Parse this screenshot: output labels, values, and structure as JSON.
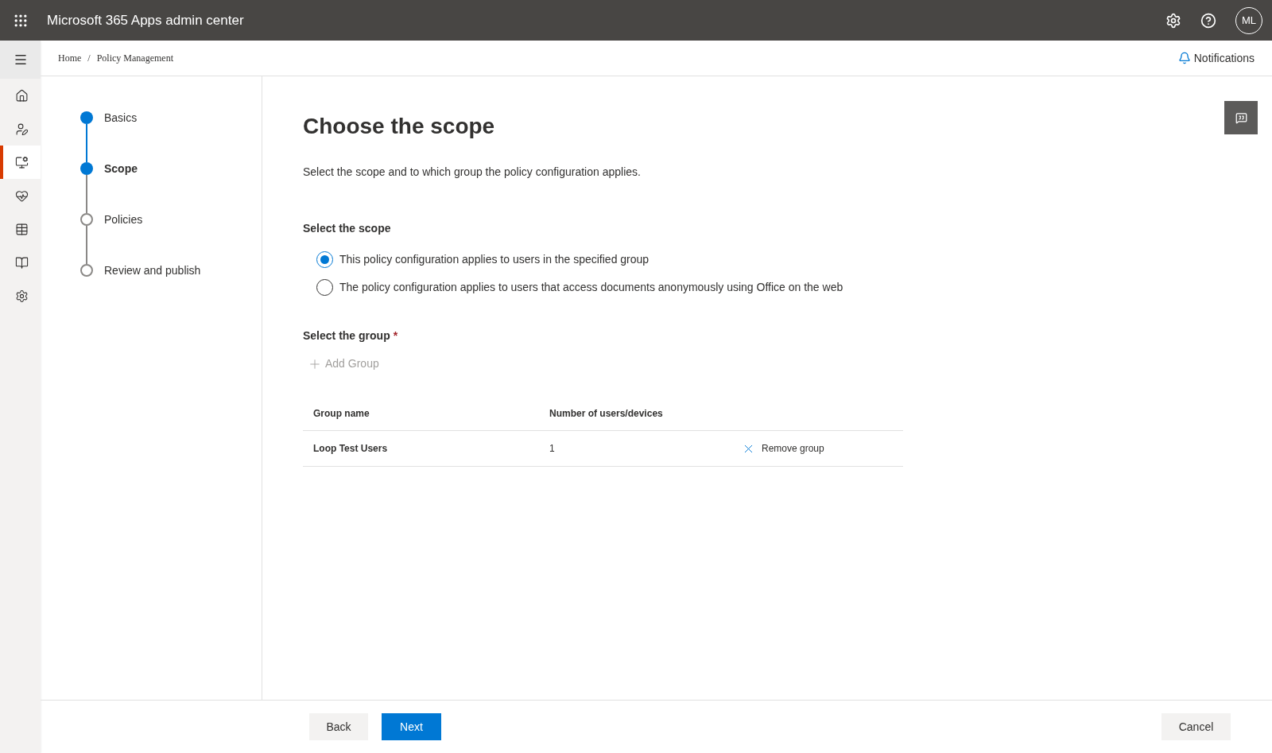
{
  "header": {
    "title": "Microsoft 365 Apps admin center",
    "avatar": "ML"
  },
  "nav": [
    {
      "kind": "home",
      "selected": false
    },
    {
      "kind": "user",
      "selected": false
    },
    {
      "kind": "edit",
      "selected": true
    },
    {
      "kind": "health",
      "selected": false
    },
    {
      "kind": "table",
      "selected": false
    },
    {
      "kind": "book",
      "selected": false
    },
    {
      "kind": "settings",
      "selected": false
    }
  ],
  "breadcrumb": {
    "items": [
      "Home",
      "Policy Management"
    ],
    "separator": "/"
  },
  "notifications": "Notifications",
  "steps": [
    {
      "label": "Basics",
      "completed": true,
      "selected": false
    },
    {
      "label": "Scope",
      "completed": true,
      "selected": true
    },
    {
      "label": "Policies",
      "completed": false,
      "selected": false
    },
    {
      "label": "Review and publish",
      "completed": false,
      "selected": false
    }
  ],
  "title": "Choose the scope",
  "description": "Select the scope and to which group the policy configuration applies.",
  "scope": {
    "label": "Select the scope",
    "options": [
      {
        "label": "This policy configuration applies to users in the specified group",
        "selected": true
      },
      {
        "label": "The policy configuration applies to users that access documents anonymously using Office on the web",
        "selected": false
      }
    ]
  },
  "group": {
    "label": "Select the group",
    "required_mark": "*",
    "add_button": {
      "label": "Add Group",
      "disabled": true
    },
    "columns": [
      "Group name",
      "Number of users/devices"
    ],
    "rows": [
      {
        "name": "Loop Test Users",
        "count": "1",
        "action": "Remove group"
      }
    ]
  },
  "footer": {
    "back": "Back",
    "next": "Next",
    "cancel": "Cancel"
  }
}
